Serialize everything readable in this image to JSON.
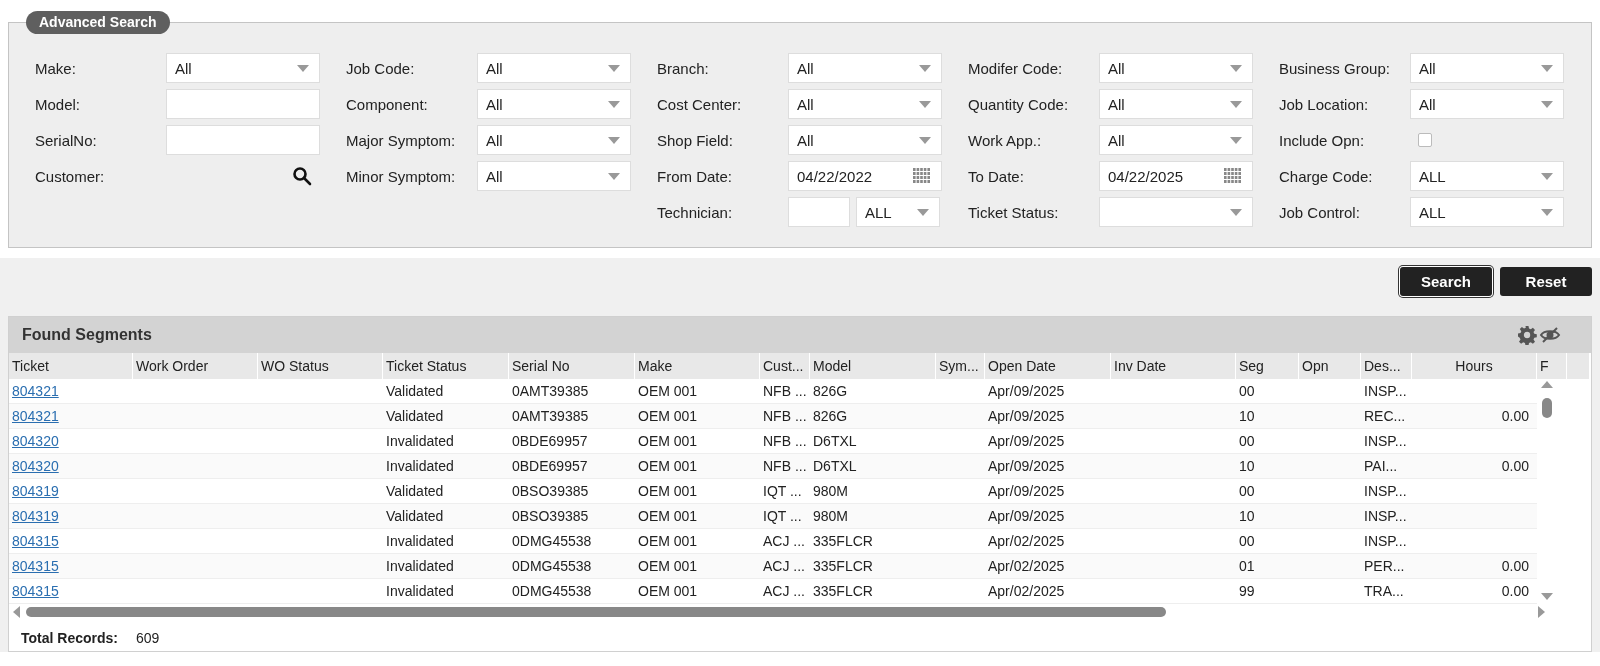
{
  "advanced_search": {
    "title": "Advanced Search",
    "columns": [
      [
        {
          "kind": "select",
          "label": "Make:",
          "value": "All"
        },
        {
          "kind": "text",
          "label": "Model:"
        },
        {
          "kind": "text",
          "label": "SerialNo:"
        },
        {
          "kind": "lookup",
          "label": "Customer:"
        }
      ],
      [
        {
          "kind": "select",
          "label": "Job Code:",
          "value": "All"
        },
        {
          "kind": "select",
          "label": "Component:",
          "value": "All"
        },
        {
          "kind": "select",
          "label": "Major Symptom:",
          "value": "All"
        },
        {
          "kind": "select",
          "label": "Minor Symptom:",
          "value": "All"
        }
      ],
      [
        {
          "kind": "select",
          "label": "Branch:",
          "value": "All"
        },
        {
          "kind": "select",
          "label": "Cost Center:",
          "value": "All"
        },
        {
          "kind": "select",
          "label": "Shop Field:",
          "value": "All"
        },
        {
          "kind": "date",
          "label": "From Date:",
          "value": "04/22/2022"
        },
        {
          "kind": "tech",
          "label": "Technician:",
          "value": "ALL"
        }
      ],
      [
        {
          "kind": "select",
          "label": "Modifer Code:",
          "value": "All"
        },
        {
          "kind": "select",
          "label": "Quantity Code:",
          "value": "All"
        },
        {
          "kind": "select",
          "label": "Work App.:",
          "value": "All"
        },
        {
          "kind": "date",
          "label": "To Date:",
          "value": "04/22/2025"
        },
        {
          "kind": "select",
          "label": "Ticket Status:"
        }
      ],
      [
        {
          "kind": "select",
          "label": "Business Group:",
          "value": "All"
        },
        {
          "kind": "select",
          "label": "Job Location:",
          "value": "All"
        },
        {
          "kind": "checkbox",
          "label": "Include Opn:",
          "checked": false
        },
        {
          "kind": "select",
          "label": "Charge Code:",
          "value": "ALL"
        },
        {
          "kind": "select",
          "label": "Job Control:",
          "value": "ALL"
        }
      ]
    ]
  },
  "buttons": [
    "Search",
    "Reset"
  ],
  "found_segments": {
    "title": "Found Segments",
    "columns": [
      {
        "label": "Ticket",
        "kind": "link"
      },
      {
        "label": "Work Order",
        "kind": "text"
      },
      {
        "label": "WO Status",
        "kind": "text"
      },
      {
        "label": "Ticket Status",
        "kind": "text"
      },
      {
        "label": "Serial No",
        "kind": "text"
      },
      {
        "label": "Make",
        "kind": "text"
      },
      {
        "label": "Cust...",
        "kind": "text"
      },
      {
        "label": "Model",
        "kind": "text"
      },
      {
        "label": "Sym...",
        "kind": "text"
      },
      {
        "label": "Open Date",
        "kind": "text"
      },
      {
        "label": "Inv Date",
        "kind": "text"
      },
      {
        "label": "Seg",
        "kind": "text"
      },
      {
        "label": "Opn",
        "kind": "text"
      },
      {
        "label": "Des...",
        "kind": "text"
      },
      {
        "label": "Hours",
        "kind": "number"
      },
      {
        "label": "F",
        "kind": "text"
      }
    ],
    "rows": [
      {
        "ticket": "804321",
        "ticket_status": "Validated",
        "serial_no": "0AMT39385",
        "make": "OEM 001",
        "cust": "NFB ...",
        "model": "826G",
        "open_date": "Apr/09/2025",
        "seg": "00",
        "des": "INSP..."
      },
      {
        "ticket": "804321",
        "ticket_status": "Validated",
        "serial_no": "0AMT39385",
        "make": "OEM 001",
        "cust": "NFB ...",
        "model": "826G",
        "open_date": "Apr/09/2025",
        "seg": "10",
        "des": "REC...",
        "hours": "0.00"
      },
      {
        "ticket": "804320",
        "ticket_status": "Invalidated",
        "serial_no": "0BDE69957",
        "make": "OEM 001",
        "cust": "NFB ...",
        "model": "D6TXL",
        "open_date": "Apr/09/2025",
        "seg": "00",
        "des": "INSP..."
      },
      {
        "ticket": "804320",
        "ticket_status": "Invalidated",
        "serial_no": "0BDE69957",
        "make": "OEM 001",
        "cust": "NFB ...",
        "model": "D6TXL",
        "open_date": "Apr/09/2025",
        "seg": "10",
        "des": "PAI...",
        "hours": "0.00"
      },
      {
        "ticket": "804319",
        "ticket_status": "Validated",
        "serial_no": "0BSO39385",
        "make": "OEM 001",
        "cust": "IQT ...",
        "model": "980M",
        "open_date": "Apr/09/2025",
        "seg": "00",
        "des": "INSP..."
      },
      {
        "ticket": "804319",
        "ticket_status": "Validated",
        "serial_no": "0BSO39385",
        "make": "OEM 001",
        "cust": "IQT ...",
        "model": "980M",
        "open_date": "Apr/09/2025",
        "seg": "10",
        "des": "INSP..."
      },
      {
        "ticket": "804315",
        "ticket_status": "Invalidated",
        "serial_no": "0DMG45538",
        "make": "OEM 001",
        "cust": "ACJ ...",
        "model": "335FLCR",
        "open_date": "Apr/02/2025",
        "seg": "00",
        "des": "INSP..."
      },
      {
        "ticket": "804315",
        "ticket_status": "Invalidated",
        "serial_no": "0DMG45538",
        "make": "OEM 001",
        "cust": "ACJ ...",
        "model": "335FLCR",
        "open_date": "Apr/02/2025",
        "seg": "01",
        "des": "PER...",
        "hours": "0.00"
      },
      {
        "ticket": "804315",
        "ticket_status": "Invalidated",
        "serial_no": "0DMG45538",
        "make": "OEM 001",
        "cust": "ACJ ...",
        "model": "335FLCR",
        "open_date": "Apr/02/2025",
        "seg": "99",
        "des": "TRA...",
        "hours": "0.00"
      }
    ],
    "total_label": "Total Records:",
    "total_value": "609"
  }
}
